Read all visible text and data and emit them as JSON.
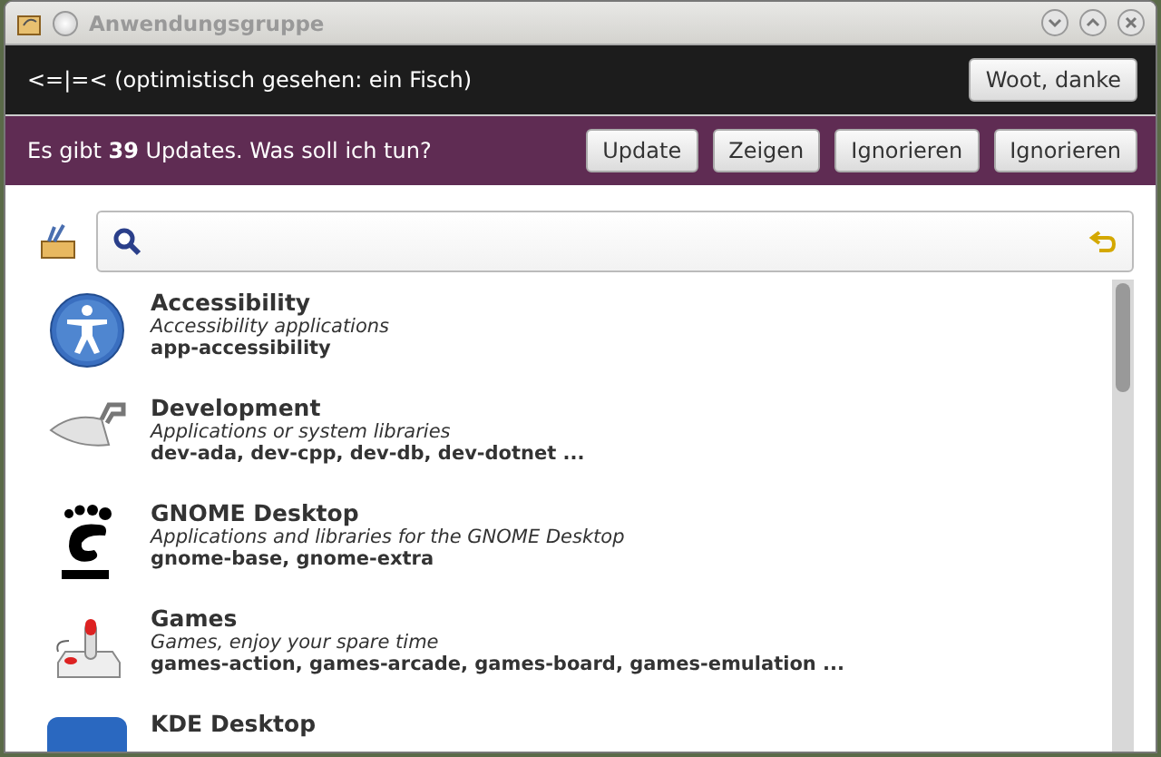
{
  "window": {
    "title": "Anwendungsgruppe"
  },
  "message_bar": {
    "text": "<=|=< (optimistisch gesehen: ein Fisch)",
    "button": "Woot, danke"
  },
  "update_bar": {
    "text": "Es gibt **39** Updates. Was soll ich tun?",
    "buttons": [
      "Update",
      "Zeigen",
      "Ignorieren",
      "Ignorieren"
    ]
  },
  "groups": [
    {
      "kind": "accessibility",
      "name": "Accessibility",
      "description": "Accessibility applications",
      "packages": "app-accessibility"
    },
    {
      "kind": "development",
      "name": "Development",
      "description": "Applications or system libraries",
      "packages": "dev-ada, dev-cpp, dev-db, dev-dotnet ..."
    },
    {
      "kind": "gnome",
      "name": "GNOME Desktop",
      "description": "Applications and libraries for the GNOME Desktop",
      "packages": "gnome-base, gnome-extra"
    },
    {
      "kind": "games",
      "name": "Games",
      "description": "Games, enjoy your spare time",
      "packages": "games-action, games-arcade, games-board, games-emulation ..."
    },
    {
      "kind": "kde",
      "name": "KDE Desktop"
    }
  ]
}
